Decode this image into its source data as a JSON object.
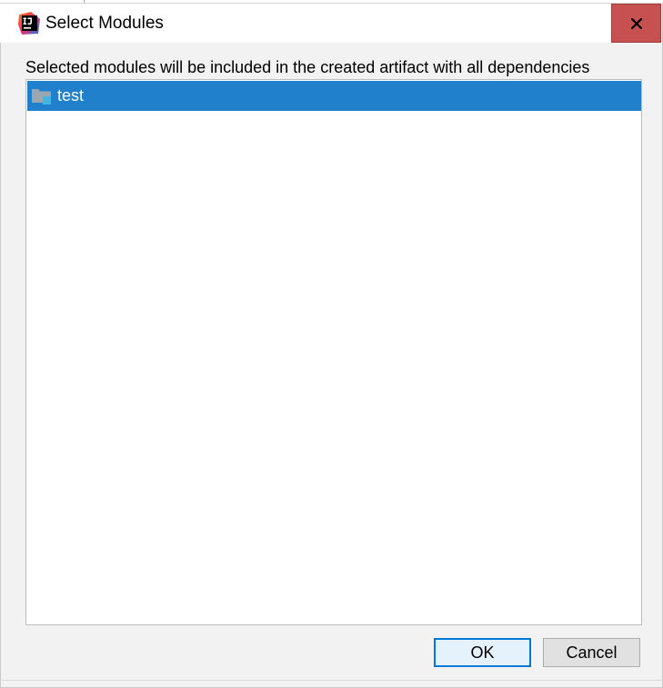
{
  "window": {
    "title": "Select Modules",
    "app_icon": "intellij-idea-icon",
    "close_icon": "close-icon"
  },
  "description": "Selected modules will be included in the created artifact with all dependencies",
  "modules": [
    {
      "label": "test",
      "icon": "module-folder-icon",
      "selected": true
    }
  ],
  "buttons": {
    "ok_label": "OK",
    "cancel_label": "Cancel"
  },
  "colors": {
    "selection": "#2180cb",
    "close_button": "#c75050",
    "default_button_border": "#0078d7"
  }
}
